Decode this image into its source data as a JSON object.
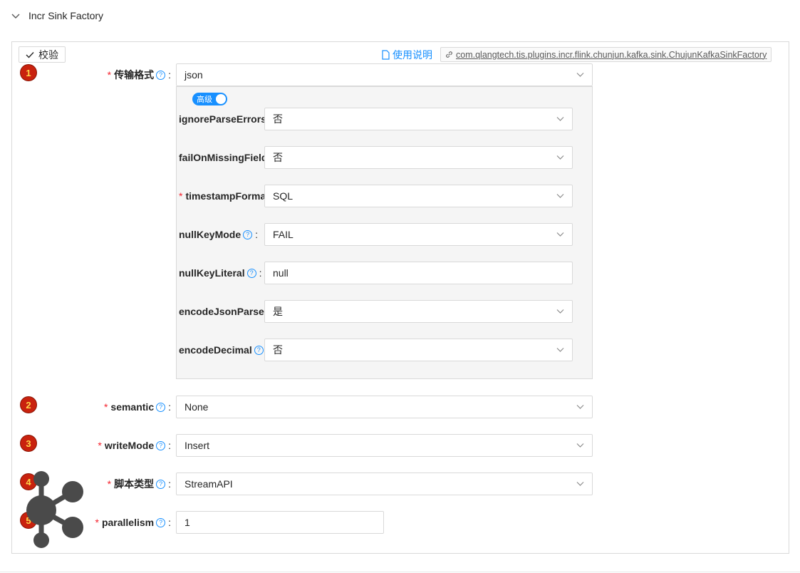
{
  "section": {
    "title": "Incr Sink Factory"
  },
  "toolbar": {
    "validate_label": "校验",
    "doc_label": "使用说明",
    "class_name": "com.qlangtech.tis.plugins.incr.flink.chunjun.kafka.sink.ChujunKafkaSinkFactory"
  },
  "badges": [
    "1",
    "2",
    "3",
    "4",
    "5"
  ],
  "fields": {
    "format": {
      "label": "传输格式",
      "value": "json"
    },
    "semantic": {
      "label": "semantic",
      "value": "None"
    },
    "write_mode": {
      "label": "writeMode",
      "value": "Insert"
    },
    "script_type": {
      "label": "脚本类型",
      "value": "StreamAPI"
    },
    "parallelism": {
      "label": "parallelism",
      "value": "1"
    }
  },
  "advanced": {
    "toggle_label": "高级",
    "fields": {
      "ignore_parse_errors": {
        "label": "ignoreParseErrors",
        "value": "否"
      },
      "fail_on_missing_field": {
        "label": "failOnMissingField",
        "value": "否"
      },
      "timestamp_format": {
        "label": "timestampFormat",
        "value": "SQL"
      },
      "null_key_mode": {
        "label": "nullKeyMode",
        "value": "FAIL"
      },
      "null_key_literal": {
        "label": "nullKeyLiteral",
        "value": "null"
      },
      "encode_json_parser": {
        "label": "encodeJsonParser",
        "value": "是"
      },
      "encode_decimal": {
        "label": "encodeDecimal",
        "value": "否"
      }
    }
  },
  "colors": {
    "accent": "#1890ff",
    "required": "#f5222d",
    "badge": "#c9220e"
  }
}
